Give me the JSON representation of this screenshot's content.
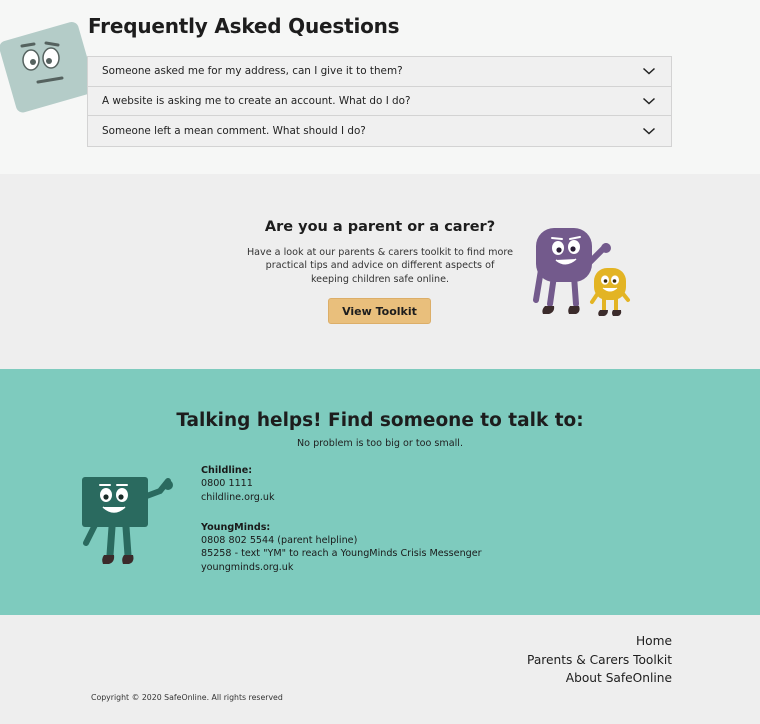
{
  "faq": {
    "title": "Frequently Asked Questions",
    "items": [
      {
        "question": "Someone asked me for my address, can I give it to them?"
      },
      {
        "question": "A website is asking me to create an account. What do I do?"
      },
      {
        "question": "Someone left a mean comment. What should I do?"
      }
    ]
  },
  "parent": {
    "title": "Are you a parent or a carer?",
    "description": "Have a look at  our parents & carers toolkit to find more practical tips and advice on different aspects of keeping children safe online.",
    "button_label": "View Toolkit"
  },
  "talk": {
    "title": "Talking helps! Find someone to talk to:",
    "subtitle": "No problem is too big or too small.",
    "contacts": [
      {
        "name": "Childline:",
        "lines": [
          "0800 1111",
          "childline.org.uk"
        ]
      },
      {
        "name": "YoungMinds:",
        "lines": [
          "0808 802 5544 (parent helpline)",
          "85258 - text \"YM\" to reach a YoungMinds Crisis Messenger",
          "youngminds.org.uk"
        ]
      }
    ]
  },
  "footer": {
    "links": [
      "Home",
      "Parents & Carers Toolkit",
      "About SafeOnline"
    ],
    "copyright": "Copyright © 2020 SafeOnline. All rights reserved"
  },
  "colors": {
    "faq_bg": "#f6f7f6",
    "parent_bg": "#eeeeee",
    "talk_bg": "#7ecbbe",
    "button": "#e9bf7c",
    "mascot_purple": "#735a8c",
    "mascot_yellow": "#e3b424",
    "mascot_green": "#2a6a5f",
    "mascot_grey": "#b4ccc8"
  },
  "icons": [
    "chevron-down-icon",
    "confused-mascot-icon",
    "waving-mascots-icon",
    "waving-green-mascot-icon"
  ]
}
